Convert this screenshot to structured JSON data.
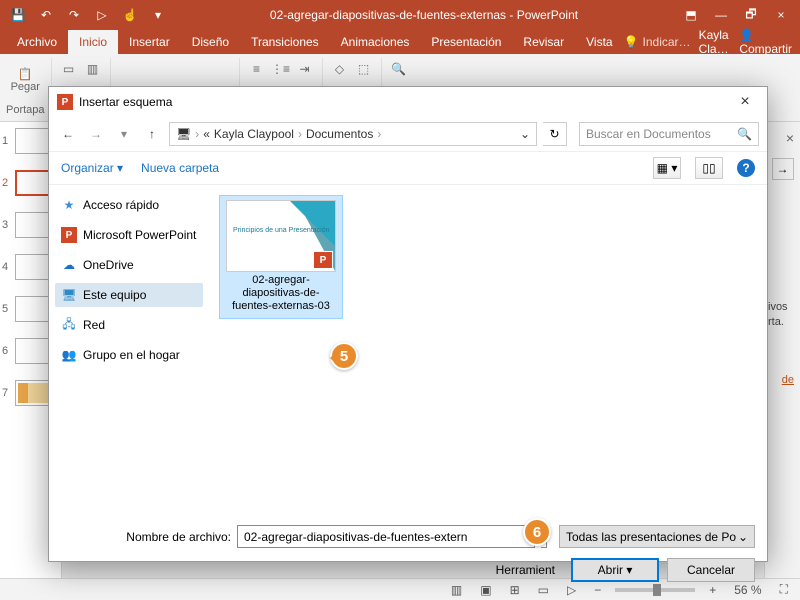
{
  "titlebar": {
    "doc": "02-agregar-diapositivas-de-fuentes-externas - PowerPoint"
  },
  "win": {
    "restore": "🗗",
    "close": "×",
    "ribbon_opts": "⬒",
    "min": "—"
  },
  "qat": {
    "redo": "↷",
    "undo": "↶",
    "more": "▾",
    "touch": "☝",
    "save": "💾",
    "start": "▷"
  },
  "tabs": {
    "archivo": "Archivo",
    "inicio": "Inicio",
    "insertar": "Insertar",
    "diseno": "Diseño",
    "transiciones": "Transiciones",
    "animaciones": "Animaciones",
    "presentacion": "Presentación",
    "revisar": "Revisar",
    "vista": "Vista"
  },
  "tell": "Indicar…",
  "user": "Kayla Cla…",
  "share": "Compartir",
  "ribbon": {
    "pegar": "Pegar",
    "portapapeles": "Portapa"
  },
  "thumbs": [
    "1",
    "2",
    "3",
    "4",
    "5",
    "6",
    "7"
  ],
  "props": {
    "text1": "ivos\nrta.",
    "link": "de"
  },
  "status": {
    "zoom": "56 %",
    "fit": "⛶"
  },
  "dialog": {
    "title": "Insertar esquema",
    "crumbs": [
      "«",
      "Kayla Claypool",
      "Documentos"
    ],
    "search_ph": "Buscar en Documentos",
    "toolbar": {
      "organizar": "Organizar ▾",
      "nueva": "Nueva carpeta"
    },
    "tree": [
      {
        "icon": "★",
        "label": "Acceso rápido",
        "color": "#3b8ed8"
      },
      {
        "icon": "P",
        "label": "Microsoft PowerPoint",
        "color": "#d24726"
      },
      {
        "icon": "☁",
        "label": "OneDrive",
        "color": "#1a72c6"
      },
      {
        "icon": "🖥",
        "label": "Este equipo",
        "color": "#2d89c7",
        "sel": true
      },
      {
        "icon": "⬢",
        "label": "Red",
        "color": "#2d89c7"
      },
      {
        "icon": "⚗",
        "label": "Grupo en el hogar",
        "color": "#2d89c7"
      }
    ],
    "file": {
      "name": "02-agregar-diapositivas-de-fuentes-externas-03",
      "thumb_text": "Principios de una\nPresentación"
    },
    "name_label": "Nombre de archivo:",
    "name_value": "02-agregar-diapositivas-de-fuentes-extern",
    "filter": "Todas las presentaciones de Po",
    "tools": "Herramient",
    "open": "Abrir",
    "cancel": "Cancelar"
  },
  "callouts": {
    "c5": "5",
    "c6": "6"
  }
}
